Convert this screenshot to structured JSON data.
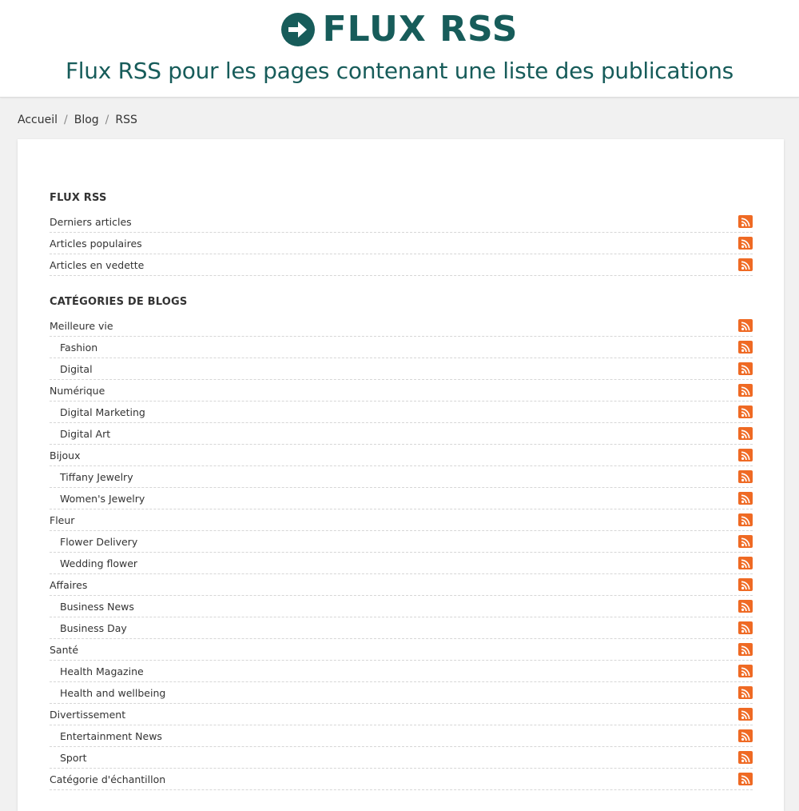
{
  "header": {
    "title": "FLUX RSS",
    "subtitle": "Flux RSS pour les pages contenant une liste des publications"
  },
  "breadcrumb": [
    "Accueil",
    "Blog",
    "RSS"
  ],
  "feeds": {
    "title": "FLUX RSS",
    "items": [
      {
        "label": "Derniers articles"
      },
      {
        "label": "Articles populaires"
      },
      {
        "label": "Articles en vedette"
      }
    ]
  },
  "categories": {
    "title": "CATÉGORIES DE BLOGS",
    "items": [
      {
        "label": "Meilleure vie",
        "child": false
      },
      {
        "label": "Fashion",
        "child": true
      },
      {
        "label": "Digital",
        "child": true
      },
      {
        "label": "Numérique",
        "child": false
      },
      {
        "label": "Digital Marketing",
        "child": true
      },
      {
        "label": "Digital Art",
        "child": true
      },
      {
        "label": "Bijoux",
        "child": false
      },
      {
        "label": "Tiffany Jewelry",
        "child": true
      },
      {
        "label": "Women's Jewelry",
        "child": true
      },
      {
        "label": "Fleur",
        "child": false
      },
      {
        "label": "Flower Delivery",
        "child": true
      },
      {
        "label": "Wedding flower",
        "child": true
      },
      {
        "label": "Affaires",
        "child": false
      },
      {
        "label": "Business News",
        "child": true
      },
      {
        "label": "Business Day",
        "child": true
      },
      {
        "label": "Santé",
        "child": false
      },
      {
        "label": "Health Magazine",
        "child": true
      },
      {
        "label": "Health and wellbeing",
        "child": true
      },
      {
        "label": "Divertissement",
        "child": false
      },
      {
        "label": "Entertainment News",
        "child": true
      },
      {
        "label": "Sport",
        "child": true
      },
      {
        "label": "Catégorie d'échantillon",
        "child": false
      }
    ]
  },
  "colors": {
    "accent": "#175c5a",
    "rss": "#ef6a24"
  },
  "icons": {
    "title": "arrow-circle-right-icon",
    "feed": "rss-icon"
  }
}
